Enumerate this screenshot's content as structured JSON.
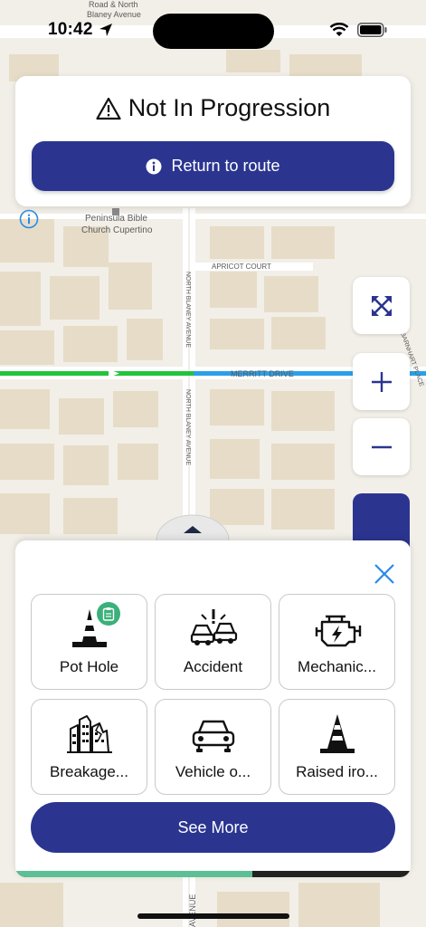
{
  "status_bar": {
    "time": "10:42"
  },
  "map": {
    "labels": {
      "top_road_1": "Road & North",
      "top_road_2": "Blaney Avenue",
      "church_1": "Peninsula Bible",
      "church_2": "Church Cupertino",
      "apricot": "APRICOT COURT",
      "merritt": "MERRITT DRIVE",
      "north_blaney_1": "NORTH BLANEY AVENUE",
      "north_blaney_2": "NORTH BLANEY AVENUE",
      "avenue_bottom": "AVENUE",
      "barnhart": "BARNHART PLACE"
    }
  },
  "banner": {
    "title": "Not In Progression",
    "return_button": "Return to route"
  },
  "controls": {
    "expand_icon": "expand-arrows-icon",
    "zoom_in": "+",
    "zoom_out": "−"
  },
  "sheet": {
    "tiles": [
      {
        "label": "Pot Hole",
        "icon": "traffic-cone-icon",
        "badge": "clipboard-icon"
      },
      {
        "label": "Accident",
        "icon": "car-crash-icon"
      },
      {
        "label": "Mechanic...",
        "icon": "engine-icon"
      },
      {
        "label": "Breakage...",
        "icon": "broken-buildings-icon"
      },
      {
        "label": "Vehicle o...",
        "icon": "car-icon"
      },
      {
        "label": "Raised iro...",
        "icon": "road-cone-icon"
      }
    ],
    "see_more": "See More",
    "progress": 0.6
  },
  "colors": {
    "primary": "#2b3590",
    "accent_green": "#3bb07a",
    "route_green": "#22c33b",
    "route_blue": "#2aa0e8"
  }
}
